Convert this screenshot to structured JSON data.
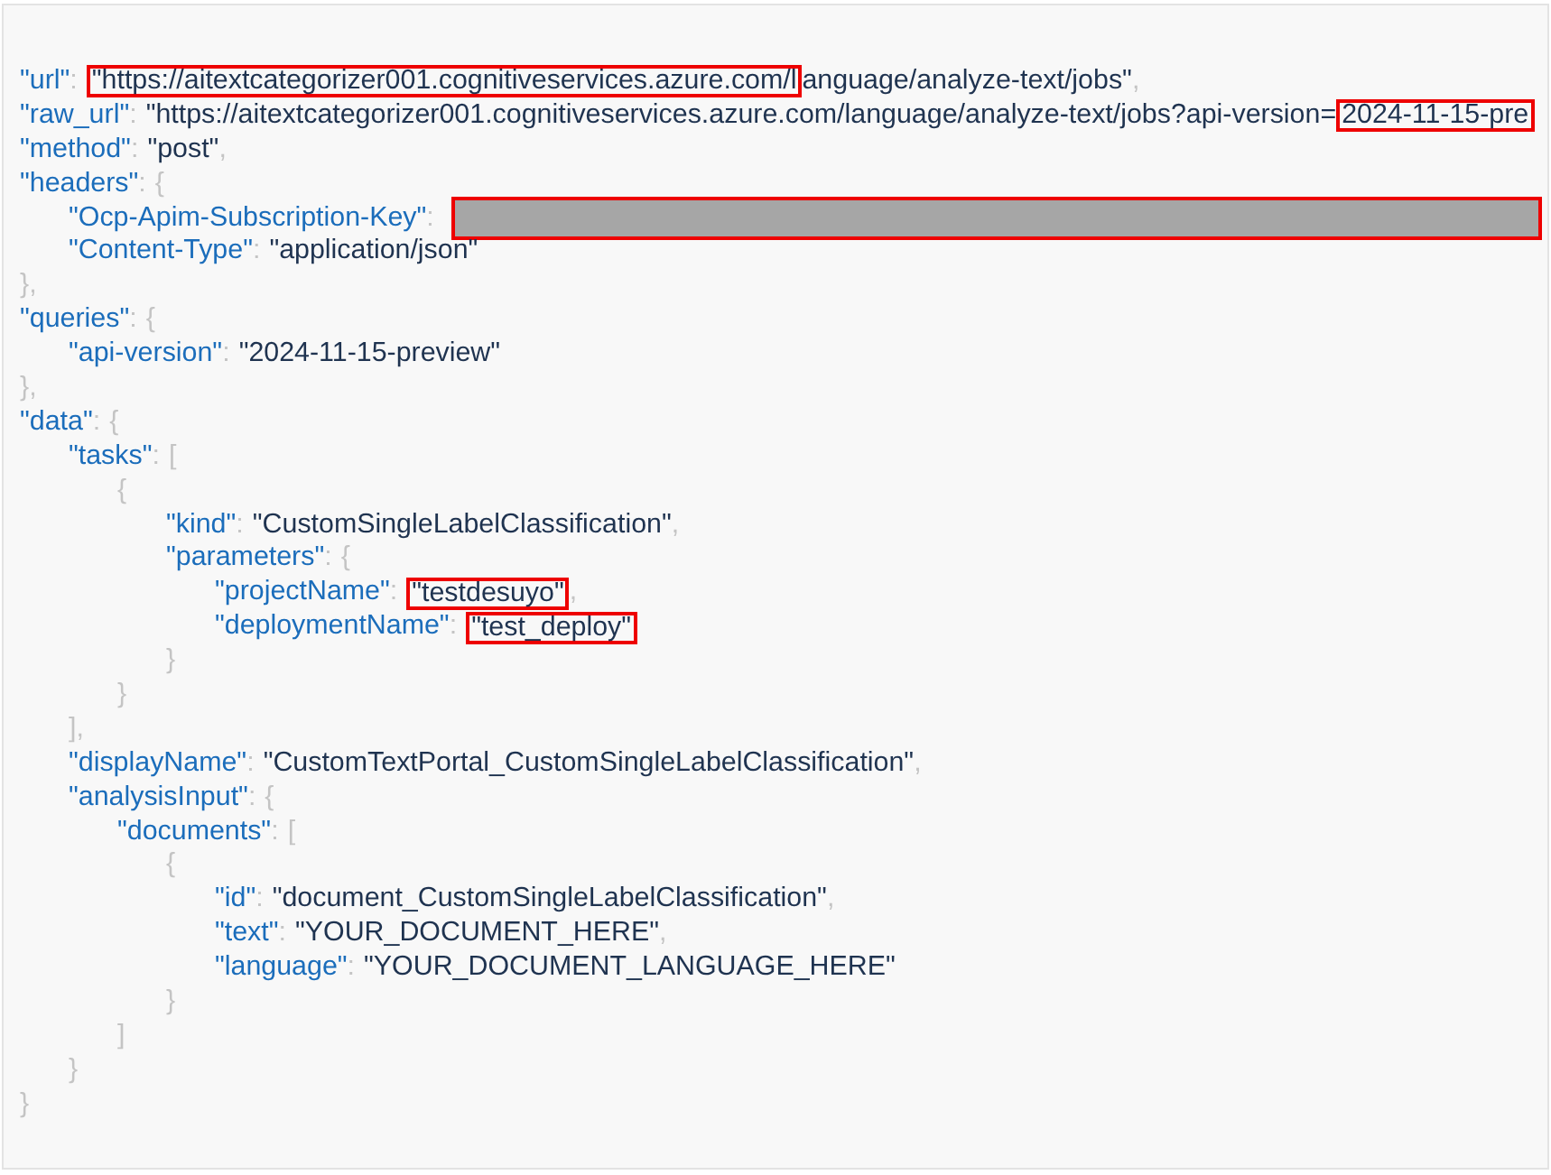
{
  "lines": [
    {
      "tokens": [
        {
          "kind": "key",
          "text": "\"url\""
        },
        {
          "kind": "colon",
          "text": ":"
        },
        {
          "kind": "string",
          "text": "\"https://aitextcategorizer001.cognitiveservices.azure.com/l",
          "highlighted": true
        },
        {
          "kind": "string",
          "text": "anguage/analyze-text/jobs\"",
          "highlighted": false
        },
        {
          "kind": "punct",
          "text": ","
        }
      ]
    },
    {
      "tokens": [
        {
          "kind": "key",
          "text": "\"raw_url\""
        },
        {
          "kind": "colon",
          "text": ":"
        },
        {
          "kind": "string",
          "text": "\"https://aitextcategorizer001.cognitiveservices.azure.com/language/analyze-text/jobs?api-version=",
          "highlighted": false
        },
        {
          "kind": "string",
          "text": "2024-11-15-pre",
          "highlighted": true
        }
      ]
    },
    {
      "tokens": [
        {
          "kind": "key",
          "text": "\"method\""
        },
        {
          "kind": "colon",
          "text": ":"
        },
        {
          "kind": "string",
          "text": "\"post\"",
          "highlighted": false
        },
        {
          "kind": "punct",
          "text": ","
        }
      ]
    },
    {
      "tokens": [
        {
          "kind": "key",
          "text": "\"headers\""
        },
        {
          "kind": "colon",
          "text": ":"
        },
        {
          "kind": "punct",
          "text": "{"
        }
      ],
      "children": [
        {
          "tokens": [
            {
              "kind": "key",
              "text": "\"Ocp-Apim-Subscription-Key\""
            },
            {
              "kind": "colon",
              "text": ":"
            },
            {
              "kind": "redacted",
              "highlighted": true
            }
          ]
        },
        {
          "tokens": [
            {
              "kind": "key",
              "text": "\"Content-Type\""
            },
            {
              "kind": "colon",
              "text": ":"
            },
            {
              "kind": "string",
              "text": "\"application/json\"",
              "highlighted": false
            }
          ]
        }
      ]
    },
    {
      "tokens": [
        {
          "kind": "punct",
          "text": "},"
        }
      ]
    },
    {
      "tokens": [
        {
          "kind": "key",
          "text": "\"queries\""
        },
        {
          "kind": "colon",
          "text": ":"
        },
        {
          "kind": "punct",
          "text": "{"
        }
      ],
      "children": [
        {
          "tokens": [
            {
              "kind": "key",
              "text": "\"api-version\""
            },
            {
              "kind": "colon",
              "text": ":"
            },
            {
              "kind": "string",
              "text": "\"2024-11-15-preview\"",
              "highlighted": false
            }
          ]
        }
      ]
    },
    {
      "tokens": [
        {
          "kind": "punct",
          "text": "},"
        }
      ]
    },
    {
      "tokens": [
        {
          "kind": "key",
          "text": "\"data\""
        },
        {
          "kind": "colon",
          "text": ":"
        },
        {
          "kind": "punct",
          "text": "{"
        }
      ],
      "children": [
        {
          "tokens": [
            {
              "kind": "key",
              "text": "\"tasks\""
            },
            {
              "kind": "colon",
              "text": ":"
            },
            {
              "kind": "punct",
              "text": "["
            }
          ],
          "children": [
            {
              "tokens": [
                {
                  "kind": "punct",
                  "text": "{"
                }
              ],
              "children": [
                {
                  "tokens": [
                    {
                      "kind": "key",
                      "text": "\"kind\""
                    },
                    {
                      "kind": "colon",
                      "text": ":"
                    },
                    {
                      "kind": "string",
                      "text": "\"CustomSingleLabelClassification\"",
                      "highlighted": false
                    },
                    {
                      "kind": "punct",
                      "text": ","
                    }
                  ]
                },
                {
                  "tokens": [
                    {
                      "kind": "key",
                      "text": "\"parameters\""
                    },
                    {
                      "kind": "colon",
                      "text": ":"
                    },
                    {
                      "kind": "punct",
                      "text": "{"
                    }
                  ],
                  "children": [
                    {
                      "tokens": [
                        {
                          "kind": "key",
                          "text": "\"projectName\""
                        },
                        {
                          "kind": "colon",
                          "text": ":"
                        },
                        {
                          "kind": "string",
                          "text": "\"testdesuyo\"",
                          "highlighted": true
                        },
                        {
                          "kind": "punct",
                          "text": ","
                        }
                      ]
                    },
                    {
                      "tokens": [
                        {
                          "kind": "key",
                          "text": "\"deploymentName\""
                        },
                        {
                          "kind": "colon",
                          "text": ":"
                        },
                        {
                          "kind": "string",
                          "text": "\"test_deploy\"",
                          "highlighted": true
                        }
                      ]
                    }
                  ]
                },
                {
                  "tokens": [
                    {
                      "kind": "punct",
                      "text": "}"
                    }
                  ]
                }
              ]
            },
            {
              "tokens": [
                {
                  "kind": "punct",
                  "text": "}"
                }
              ]
            }
          ]
        },
        {
          "tokens": [
            {
              "kind": "punct",
              "text": "],"
            }
          ]
        },
        {
          "tokens": [
            {
              "kind": "key",
              "text": "\"displayName\""
            },
            {
              "kind": "colon",
              "text": ":"
            },
            {
              "kind": "string",
              "text": "\"CustomTextPortal_CustomSingleLabelClassification\"",
              "highlighted": false
            },
            {
              "kind": "punct",
              "text": ","
            }
          ]
        },
        {
          "tokens": [
            {
              "kind": "key",
              "text": "\"analysisInput\""
            },
            {
              "kind": "colon",
              "text": ":"
            },
            {
              "kind": "punct",
              "text": "{"
            }
          ],
          "children": [
            {
              "tokens": [
                {
                  "kind": "key",
                  "text": "\"documents\""
                },
                {
                  "kind": "colon",
                  "text": ":"
                },
                {
                  "kind": "punct",
                  "text": "["
                }
              ],
              "children": [
                {
                  "tokens": [
                    {
                      "kind": "punct",
                      "text": "{"
                    }
                  ],
                  "children": [
                    {
                      "tokens": [
                        {
                          "kind": "key",
                          "text": "\"id\""
                        },
                        {
                          "kind": "colon",
                          "text": ":"
                        },
                        {
                          "kind": "string",
                          "text": "\"document_CustomSingleLabelClassification\"",
                          "highlighted": false
                        },
                        {
                          "kind": "punct",
                          "text": ","
                        }
                      ]
                    },
                    {
                      "tokens": [
                        {
                          "kind": "key",
                          "text": "\"text\""
                        },
                        {
                          "kind": "colon",
                          "text": ":"
                        },
                        {
                          "kind": "string",
                          "text": "\"YOUR_DOCUMENT_HERE\"",
                          "highlighted": false
                        },
                        {
                          "kind": "punct",
                          "text": ","
                        }
                      ]
                    },
                    {
                      "tokens": [
                        {
                          "kind": "key",
                          "text": "\"language\""
                        },
                        {
                          "kind": "colon",
                          "text": ":"
                        },
                        {
                          "kind": "string",
                          "text": "\"YOUR_DOCUMENT_LANGUAGE_HERE\"",
                          "highlighted": false
                        }
                      ]
                    }
                  ]
                },
                {
                  "tokens": [
                    {
                      "kind": "punct",
                      "text": "}"
                    }
                  ]
                }
              ]
            },
            {
              "tokens": [
                {
                  "kind": "punct",
                  "text": "]"
                }
              ]
            }
          ]
        },
        {
          "tokens": [
            {
              "kind": "punct",
              "text": "}"
            }
          ]
        }
      ]
    },
    {
      "tokens": [
        {
          "kind": "punct",
          "text": "}"
        }
      ]
    }
  ]
}
